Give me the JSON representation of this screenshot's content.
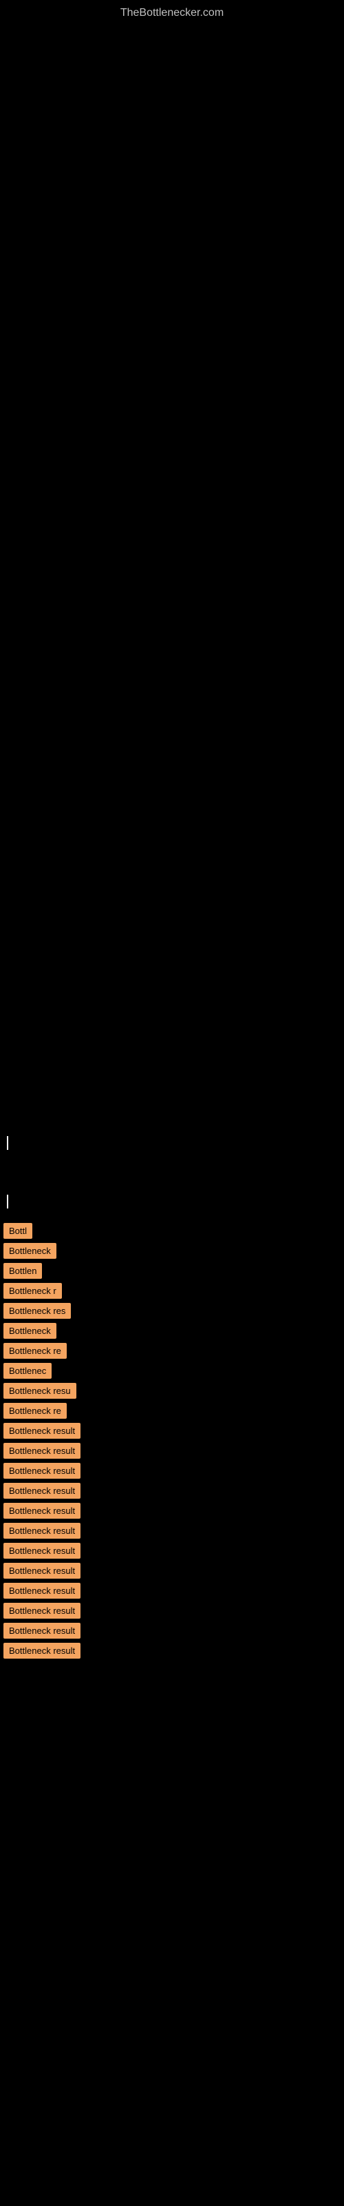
{
  "header": {
    "title": "TheBottlenecker.com"
  },
  "cursors": [
    {
      "id": "cursor1"
    },
    {
      "id": "cursor2"
    }
  ],
  "items": [
    {
      "id": 1,
      "label": "Bottl"
    },
    {
      "id": 2,
      "label": "Bottleneck"
    },
    {
      "id": 3,
      "label": "Bottlen"
    },
    {
      "id": 4,
      "label": "Bottleneck r"
    },
    {
      "id": 5,
      "label": "Bottleneck res"
    },
    {
      "id": 6,
      "label": "Bottleneck"
    },
    {
      "id": 7,
      "label": "Bottleneck re"
    },
    {
      "id": 8,
      "label": "Bottlenec"
    },
    {
      "id": 9,
      "label": "Bottleneck resu"
    },
    {
      "id": 10,
      "label": "Bottleneck re"
    },
    {
      "id": 11,
      "label": "Bottleneck result"
    },
    {
      "id": 12,
      "label": "Bottleneck result"
    },
    {
      "id": 13,
      "label": "Bottleneck result"
    },
    {
      "id": 14,
      "label": "Bottleneck result"
    },
    {
      "id": 15,
      "label": "Bottleneck result"
    },
    {
      "id": 16,
      "label": "Bottleneck result"
    },
    {
      "id": 17,
      "label": "Bottleneck result"
    },
    {
      "id": 18,
      "label": "Bottleneck result"
    },
    {
      "id": 19,
      "label": "Bottleneck result"
    },
    {
      "id": 20,
      "label": "Bottleneck result"
    },
    {
      "id": 21,
      "label": "Bottleneck result"
    },
    {
      "id": 22,
      "label": "Bottleneck result"
    }
  ]
}
